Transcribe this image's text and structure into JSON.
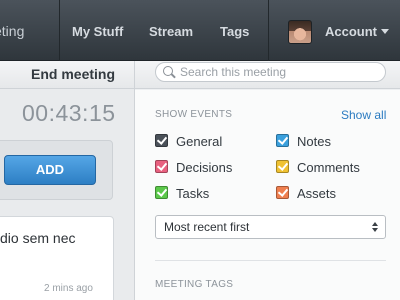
{
  "nav": {
    "brand": "eting",
    "my_stuff": "My Stuff",
    "stream": "Stream",
    "tags": "Tags",
    "account": "Account"
  },
  "subheader": {
    "end_meeting": "End meeting",
    "search_placeholder": "Search this meeting"
  },
  "left": {
    "timer": "00:43:15",
    "add_label": "ADD",
    "note_text": "dio sem nec",
    "note_time": "2 mins ago"
  },
  "events": {
    "heading": "SHOW EVENTS",
    "show_all": "Show all",
    "items": [
      {
        "label": "General",
        "color": "#4a5159",
        "checked": true
      },
      {
        "label": "Notes",
        "color": "#3aa0dd",
        "checked": true
      },
      {
        "label": "Decisions",
        "color": "#e8607f",
        "checked": true
      },
      {
        "label": "Comments",
        "color": "#f0c232",
        "checked": true
      },
      {
        "label": "Tasks",
        "color": "#5bc84a",
        "checked": true
      },
      {
        "label": "Assets",
        "color": "#ef7f4f",
        "checked": true
      }
    ],
    "sort_value": "Most recent first"
  },
  "tags": {
    "heading": "MEETING TAGS"
  }
}
